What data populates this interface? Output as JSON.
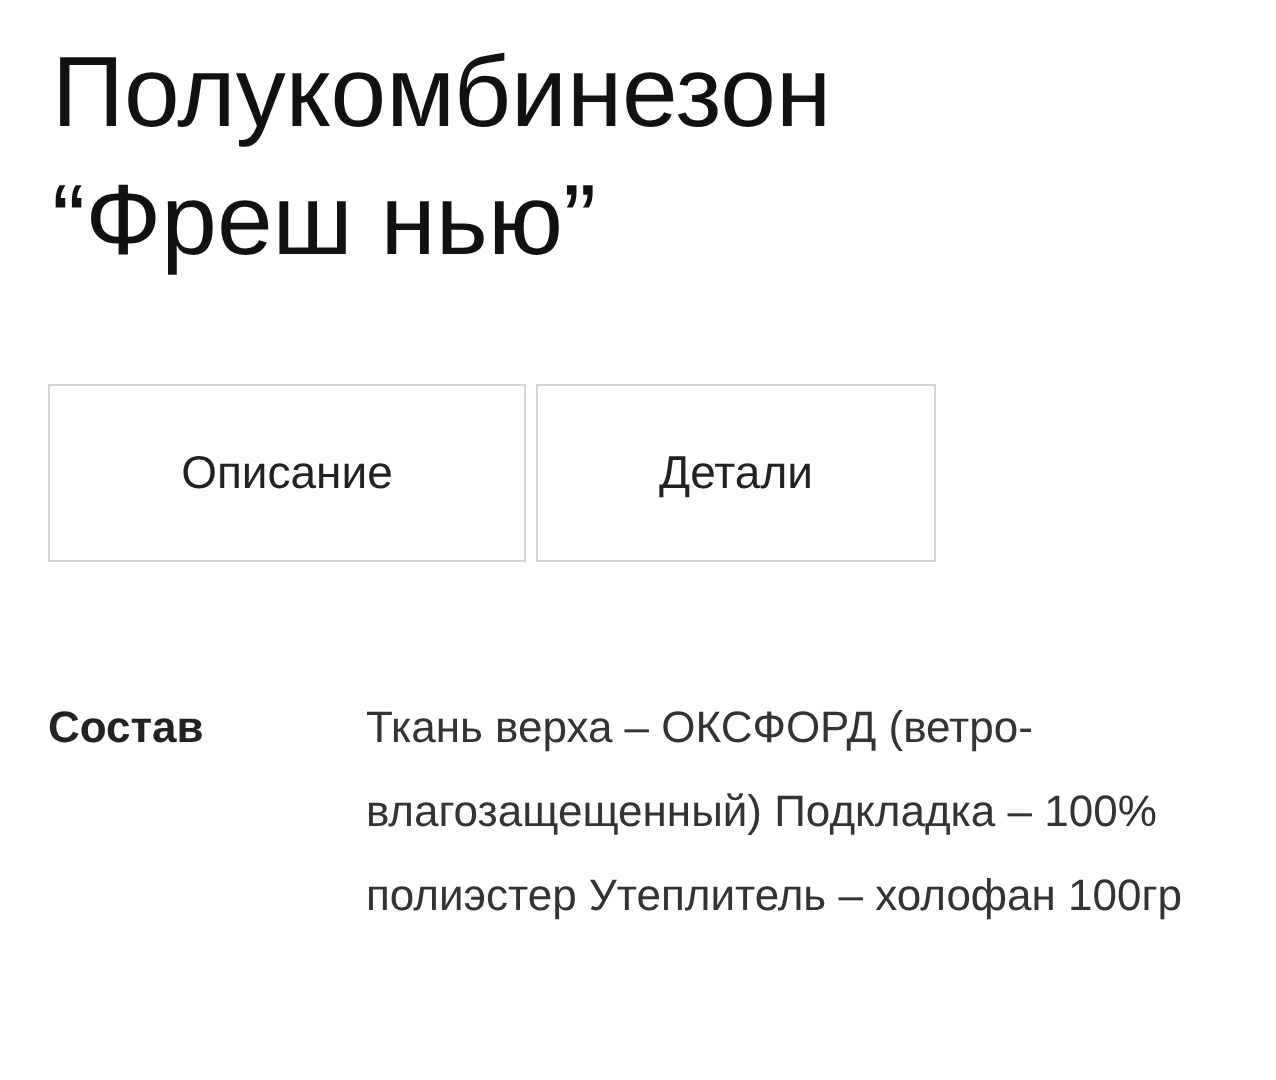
{
  "title": "Полукомбинезон “Фреш нью”",
  "tabs": [
    {
      "label": "Описание"
    },
    {
      "label": "Детали"
    }
  ],
  "details": [
    {
      "label": "Состав",
      "value": "Ткань верха – ОКСФОРД (ветро-влагозащещенный) Подкладка – 100% полиэстер Утеплитель – холофан 100гр"
    }
  ]
}
